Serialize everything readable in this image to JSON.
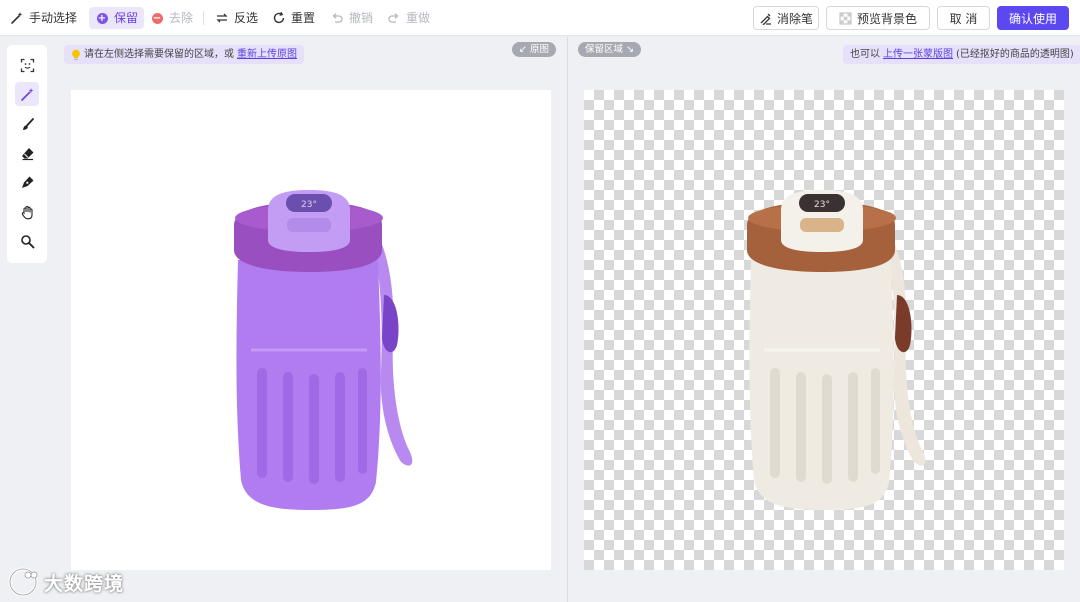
{
  "toolbar": {
    "manual_select": "手动选择",
    "keep": "保留",
    "remove": "去除",
    "invert": "反选",
    "reset": "重置",
    "undo": "撤销",
    "redo": "重做",
    "eraser_pen": "消除笔",
    "preview_bg": "预览背景色",
    "cancel": "取 消",
    "confirm": "确认使用"
  },
  "colors": {
    "accent": "#5b48f0",
    "keep_dot": "#7b55e8",
    "remove_dot": "#ef6b6b",
    "mask_purple": "#b07cf0"
  },
  "left_panel": {
    "hint_text": "请在左侧选择需要保留的区域，或",
    "hint_link": "重新上传原图",
    "chip": "↙ 原图",
    "tools": [
      "face-select-icon",
      "magic-wand-icon",
      "brush-icon",
      "eraser-icon",
      "pen-icon",
      "hand-icon",
      "zoom-icon"
    ]
  },
  "right_panel": {
    "chip": "保留区域 ↘",
    "hint_prefix": "也可以",
    "hint_link": "上传一张蒙版图",
    "hint_suffix": "(已经抠好的商品的透明图)"
  },
  "product": {
    "display_reading": "23°"
  },
  "watermark": {
    "text": "大数跨境"
  }
}
